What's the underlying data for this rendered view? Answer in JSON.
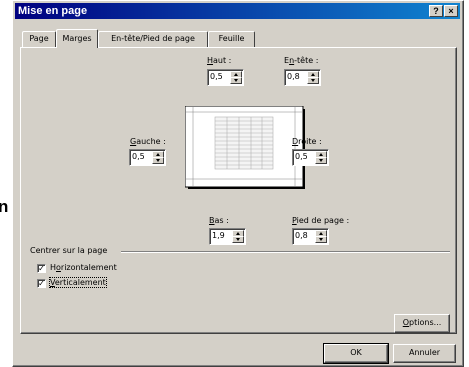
{
  "background_text": "n",
  "window": {
    "title": "Mise en page",
    "help_button": "?",
    "close_button": "×"
  },
  "tabs": [
    {
      "label": "Page",
      "active": false
    },
    {
      "label": "Marges",
      "active": true
    },
    {
      "label": "En-tête/Pied de page",
      "active": false
    },
    {
      "label": "Feuille",
      "active": false
    }
  ],
  "margins": {
    "top": {
      "label_u": "H",
      "label_rest": "aut :",
      "value": "0,5"
    },
    "header": {
      "label_a": "E",
      "label_u": "n",
      "label_rest": "-tête :",
      "value": "0,8"
    },
    "left": {
      "label_u": "G",
      "label_rest": "auche :",
      "value": "0,5"
    },
    "right": {
      "label_u": "D",
      "label_rest": "roite :",
      "value": "0,5"
    },
    "bottom": {
      "label_u": "B",
      "label_rest": "as :",
      "value": "1,9"
    },
    "footer": {
      "label_u": "P",
      "label_rest": "ied de page :",
      "value": "0,8"
    }
  },
  "center_group": {
    "title": "Centrer sur la page",
    "horizontal": {
      "label_u": "o",
      "label_a": "H",
      "label_rest": "rizontalement",
      "checked": true
    },
    "vertical": {
      "label_u": "V",
      "label_rest": "erticalement",
      "checked": true
    }
  },
  "buttons": {
    "options_u": "O",
    "options_rest": "ptions...",
    "ok": "OK",
    "cancel": "Annuler"
  },
  "colors": {
    "dialog_face": "#d4d0c8",
    "title_start": "#000080",
    "title_end": "#1084d0"
  }
}
